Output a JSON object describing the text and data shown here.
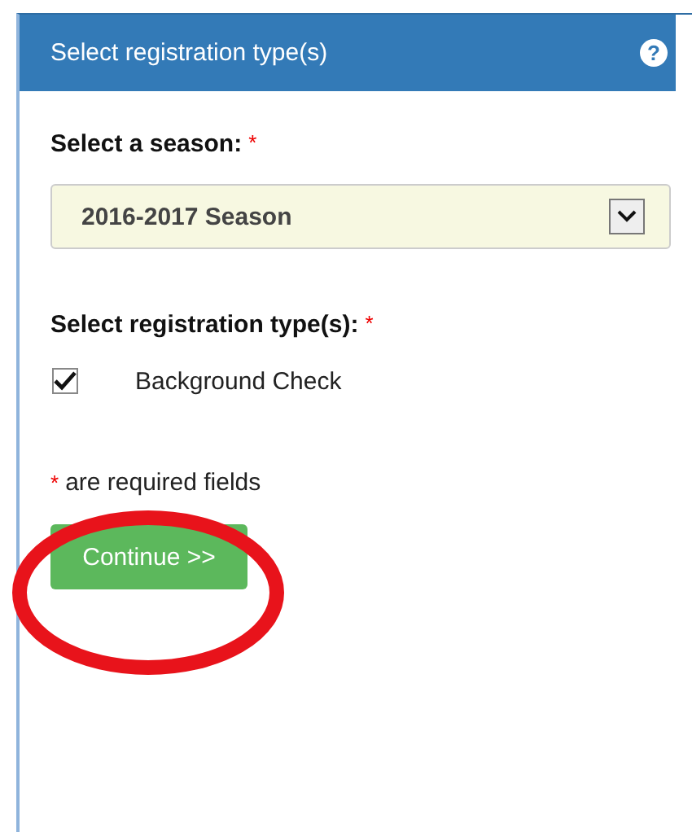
{
  "panel": {
    "title": "Select registration type(s)",
    "help_icon": "?"
  },
  "season": {
    "label": "Select a season:",
    "mark": "*",
    "value": "2016-2017 Season"
  },
  "types": {
    "label": "Select registration type(s):",
    "mark": "*",
    "options": [
      {
        "label": "Background Check",
        "checked": true
      }
    ]
  },
  "note": {
    "mark": "*",
    "text": "are required fields"
  },
  "buttons": [
    "Continue >>"
  ],
  "annotation": {
    "kind": "ellipse"
  }
}
